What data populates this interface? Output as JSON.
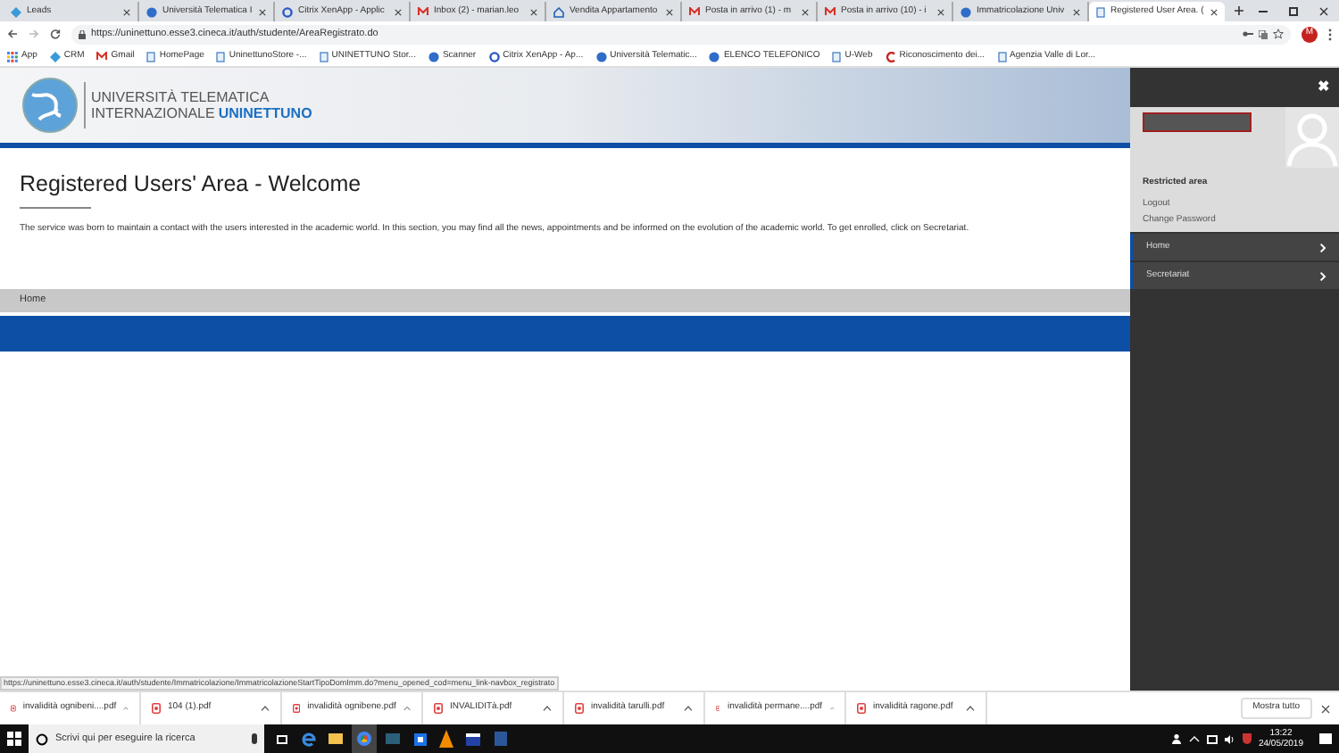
{
  "tabs": [
    {
      "label": "Leads",
      "selected": false,
      "kind": "leaf"
    },
    {
      "label": "Università Telematica I",
      "selected": false,
      "kind": "globe"
    },
    {
      "label": "Citrix XenApp - Applic",
      "selected": false,
      "kind": "circle"
    },
    {
      "label": "Inbox (2) - marian.leo",
      "selected": false,
      "kind": "mail"
    },
    {
      "label": "Vendita Appartamento",
      "selected": false,
      "kind": "house"
    },
    {
      "label": "Posta in arrivo (1) - m",
      "selected": false,
      "kind": "mail"
    },
    {
      "label": "Posta in arrivo (10) - i",
      "selected": false,
      "kind": "mail"
    },
    {
      "label": "Immatricolazione Univ",
      "selected": false,
      "kind": "globe"
    },
    {
      "label": "Registered User Area. (",
      "selected": true,
      "kind": "page"
    }
  ],
  "address": "https://uninettuno.esse3.cineca.it/auth/studente/AreaRegistrato.do",
  "profile_initial": "M",
  "bookmarks": [
    {
      "label": "App",
      "kind": "grid"
    },
    {
      "label": "CRM",
      "kind": "leaf"
    },
    {
      "label": "Gmail",
      "kind": "mail"
    },
    {
      "label": "HomePage",
      "kind": "page"
    },
    {
      "label": "UninettunoStore -...",
      "kind": "page"
    },
    {
      "label": "UNINETTUNO Stor...",
      "kind": "page"
    },
    {
      "label": "Scanner",
      "kind": "globe"
    },
    {
      "label": "Citrix XenApp - Ap...",
      "kind": "circle"
    },
    {
      "label": "Università Telematic...",
      "kind": "globe"
    },
    {
      "label": "ELENCO TELEFONICO",
      "kind": "globe"
    },
    {
      "label": "U-Web",
      "kind": "page"
    },
    {
      "label": "Riconoscimento dei...",
      "kind": "c"
    },
    {
      "label": "Agenzia Valle di Lor...",
      "kind": "page"
    }
  ],
  "site": {
    "logo_line1": "UNIVERSITÀ TELEMATICA",
    "logo_line2a": "INTERNAZIONALE",
    "logo_line2b": "UNINETTUNO",
    "title": "Registered Users' Area - Welcome",
    "intro": "The service was born to maintain a contact with the users interested in the academic world. In this section, you may find all the news, appointments and be informed on the evolution of the academic world. To get enrolled, click on Secretariat.",
    "breadcrumb": "Home"
  },
  "side_panel": {
    "close": "✖",
    "section_title": "Restricted area",
    "links": [
      "Logout",
      "Change Password"
    ],
    "menu": [
      {
        "label": "Home",
        "selected": true
      },
      {
        "label": "Secretariat",
        "selected": true
      }
    ]
  },
  "status_url": "https://uninettuno.esse3.cineca.it/auth/studente/Immatricolazione/ImmatricolazioneStartTipoDomImm.do?menu_opened_cod=menu_link-navbox_registrato",
  "downloads": [
    "invalidità ognibeni....pdf",
    "104 (1).pdf",
    "invalidità ognibene.pdf",
    "INVALIDITà.pdf",
    "invalidità tarulli.pdf",
    "invalidità permane....pdf",
    "invalidità ragone.pdf"
  ],
  "show_all": "Mostra tutto",
  "taskbar": {
    "search_placeholder": "Scrivi qui per eseguire la ricerca",
    "time": "13:22",
    "date": "24/05/2019"
  }
}
